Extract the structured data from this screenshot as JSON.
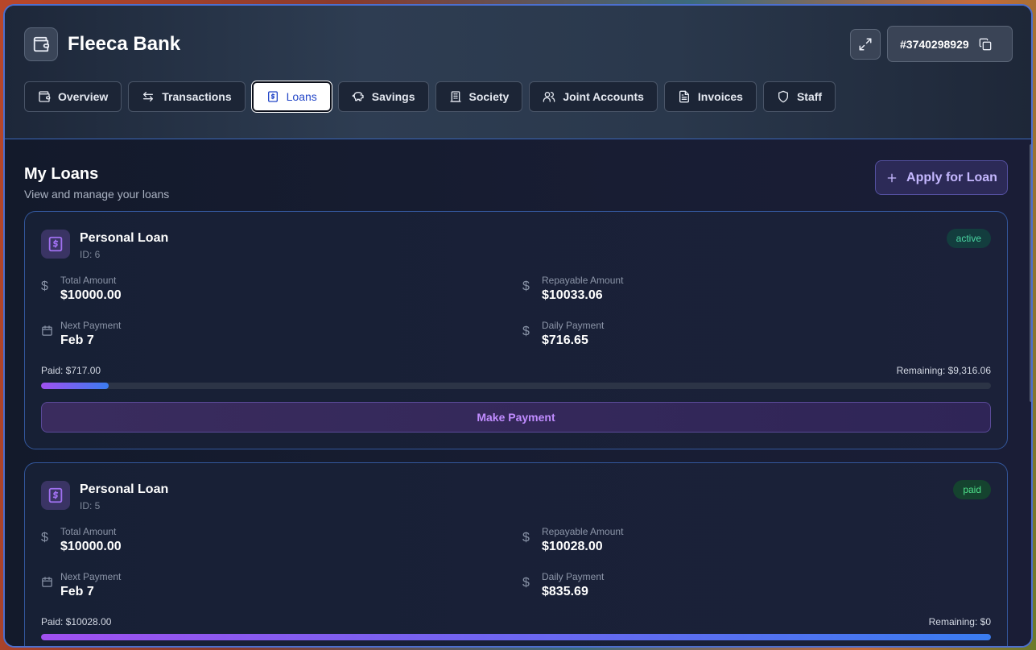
{
  "app": {
    "title": "Fleeca Bank",
    "account_number": "#3740298929"
  },
  "tabs": [
    {
      "label": "Overview",
      "icon": "wallet-icon",
      "active": false
    },
    {
      "label": "Transactions",
      "icon": "arrows-swap-icon",
      "active": false
    },
    {
      "label": "Loans",
      "icon": "receipt-dollar-icon",
      "active": true
    },
    {
      "label": "Savings",
      "icon": "piggy-bank-icon",
      "active": false
    },
    {
      "label": "Society",
      "icon": "building-icon",
      "active": false
    },
    {
      "label": "Joint Accounts",
      "icon": "users-icon",
      "active": false
    },
    {
      "label": "Invoices",
      "icon": "file-text-icon",
      "active": false
    },
    {
      "label": "Staff",
      "icon": "shield-icon",
      "active": false
    }
  ],
  "page": {
    "title": "My Loans",
    "subtitle": "View and manage your loans",
    "apply_label": "Apply for Loan"
  },
  "loans": [
    {
      "name": "Personal Loan",
      "id_label": "ID: 6",
      "status": "active",
      "total_label": "Total Amount",
      "total": "$10000.00",
      "repayable_label": "Repayable Amount",
      "repayable": "$10033.06",
      "next_label": "Next Payment",
      "next": "Feb 7",
      "daily_label": "Daily Payment",
      "daily": "$716.65",
      "paid_text": "Paid: $717.00",
      "remaining_text": "Remaining: $9,316.06",
      "progress": 0.0713,
      "pay_label": "Make Payment"
    },
    {
      "name": "Personal Loan",
      "id_label": "ID: 5",
      "status": "paid",
      "total_label": "Total Amount",
      "total": "$10000.00",
      "repayable_label": "Repayable Amount",
      "repayable": "$10028.00",
      "next_label": "Next Payment",
      "next": "Feb 7",
      "daily_label": "Daily Payment",
      "daily": "$835.69",
      "paid_text": "Paid: $10028.00",
      "remaining_text": "Remaining: $0",
      "progress": 1.0
    }
  ],
  "colors": {
    "accent": "#a050f0",
    "accent2": "#3a7cf0",
    "active_badge": "#4ad6a2",
    "paid_badge": "#4ee08a"
  }
}
